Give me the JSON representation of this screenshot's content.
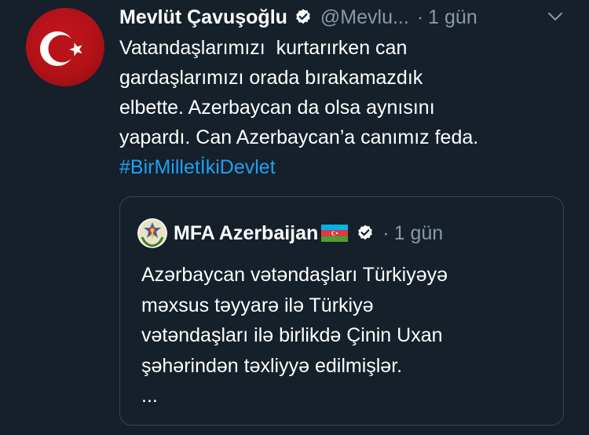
{
  "tweet": {
    "author_name": "Mevlüt Çavuşoğlu",
    "handle": "@Mevlu...",
    "separator": "·",
    "time": "1 gün",
    "body_lines": [
      "Vatandaşlarımızı  kurtarırken can",
      "gardaşlarımızı orada bırakamazdık",
      "elbette. Azerbaycan da olsa aynısını",
      "yapardı. Can Azerbaycan’a canımız feda."
    ],
    "hashtag": "#BirMilletİkiDevlet"
  },
  "quote": {
    "author_name": "MFA Azerbaijan",
    "separator": "·",
    "time": "1 gün",
    "body_lines": [
      "Azərbaycan vətəndaşları Türkiyəyə",
      "məxsus təyyarə ilə Türkiyə",
      "vətəndaşları ilə birlikdə Çinin Uxan",
      "şəhərindən təxliyyə edilmişlər."
    ],
    "truncation": "..."
  },
  "colors": {
    "background": "#15202b",
    "text": "#ffffff",
    "muted": "#8899a6",
    "link": "#1da1f2",
    "border": "#38444d"
  },
  "icons": {
    "verified": "verified-badge-icon",
    "menu": "chevron-down-icon",
    "flag": "azerbaijan-flag-icon"
  }
}
